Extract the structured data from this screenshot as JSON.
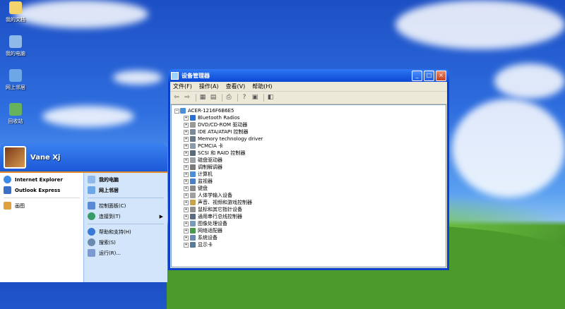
{
  "desktop": {
    "icons": [
      {
        "label": "我的文档",
        "icon": "my-documents-icon",
        "color": "#f3d36b"
      },
      {
        "label": "我的电脑",
        "icon": "my-computer-icon",
        "color": "#8fb9e8"
      },
      {
        "label": "网上邻居",
        "icon": "network-places-icon",
        "color": "#6ea7e6"
      },
      {
        "label": "回收站",
        "icon": "recycle-bin-icon",
        "color": "#67b35c"
      }
    ]
  },
  "window": {
    "title": "设备管理器",
    "controls": {
      "minimize": "_",
      "maximize": "□",
      "close": "×"
    },
    "menu": [
      "文件(F)",
      "操作(A)",
      "查看(V)",
      "帮助(H)"
    ],
    "toolbar_icons": [
      "back-icon",
      "forward-icon",
      "properties-icon",
      "help-icon",
      "print-icon",
      "help-book-icon",
      "refresh-icon",
      "device-icon"
    ],
    "tree": {
      "root": "ACER-1216F6B6E5",
      "items": [
        {
          "label": "Bluetooth Radios",
          "color": "#2a6fd6"
        },
        {
          "label": "DVD/CD-ROM 驱动器",
          "color": "#9a9a9a"
        },
        {
          "label": "IDE ATA/ATAPI 控制器",
          "color": "#7a8a9a"
        },
        {
          "label": "Memory technology driver",
          "color": "#6a7a8a"
        },
        {
          "label": "PCMCIA 卡",
          "color": "#8a9aaa"
        },
        {
          "label": "SCSI 和 RAID 控制器",
          "color": "#5a6a7a"
        },
        {
          "label": "磁盘驱动器",
          "color": "#9aa0a6"
        },
        {
          "label": "调制解调器",
          "color": "#7a7a7a"
        },
        {
          "label": "计算机",
          "color": "#4a90d8"
        },
        {
          "label": "监视器",
          "color": "#4a80c8"
        },
        {
          "label": "键盘",
          "color": "#8a8a8a"
        },
        {
          "label": "人体学输入设备",
          "color": "#a0a0a0"
        },
        {
          "label": "声音、视频和游戏控制器",
          "color": "#c9a34a"
        },
        {
          "label": "鼠标和其它指针设备",
          "color": "#909090"
        },
        {
          "label": "通用串行总线控制器",
          "color": "#5a6a80"
        },
        {
          "label": "图像处理设备",
          "color": "#7a9aba"
        },
        {
          "label": "网络适配器",
          "color": "#4a9a4a"
        },
        {
          "label": "系统设备",
          "color": "#6a8ab0"
        },
        {
          "label": "显示卡",
          "color": "#5a7a9a"
        }
      ]
    }
  },
  "start_menu": {
    "user_name": "Vane Xj",
    "pinned": [
      {
        "label": "Internet Explorer",
        "color": "#3a8ae6"
      },
      {
        "label": "Outlook Express",
        "color": "#3a70c8"
      }
    ],
    "recent": [
      {
        "label": "画图",
        "color": "#e0a040"
      }
    ],
    "right": [
      {
        "label": "我的电脑",
        "bold": true,
        "color": "#8fb9e8"
      },
      {
        "label": "网上邻居",
        "bold": true,
        "color": "#6ea7e6"
      },
      {
        "label": "控制面板(C)",
        "bold": false,
        "color": "#5a8ad6"
      },
      {
        "label": "连接到(T)",
        "bold": false,
        "color": "#3a9a6a",
        "arrow": "▶"
      },
      {
        "label": "帮助和支持(H)",
        "bold": false,
        "color": "#3a7ad6"
      },
      {
        "label": "搜索(S)",
        "bold": false,
        "color": "#6a8ab0"
      },
      {
        "label": "运行(R)...",
        "bold": false,
        "color": "#7a9ad0"
      }
    ]
  }
}
